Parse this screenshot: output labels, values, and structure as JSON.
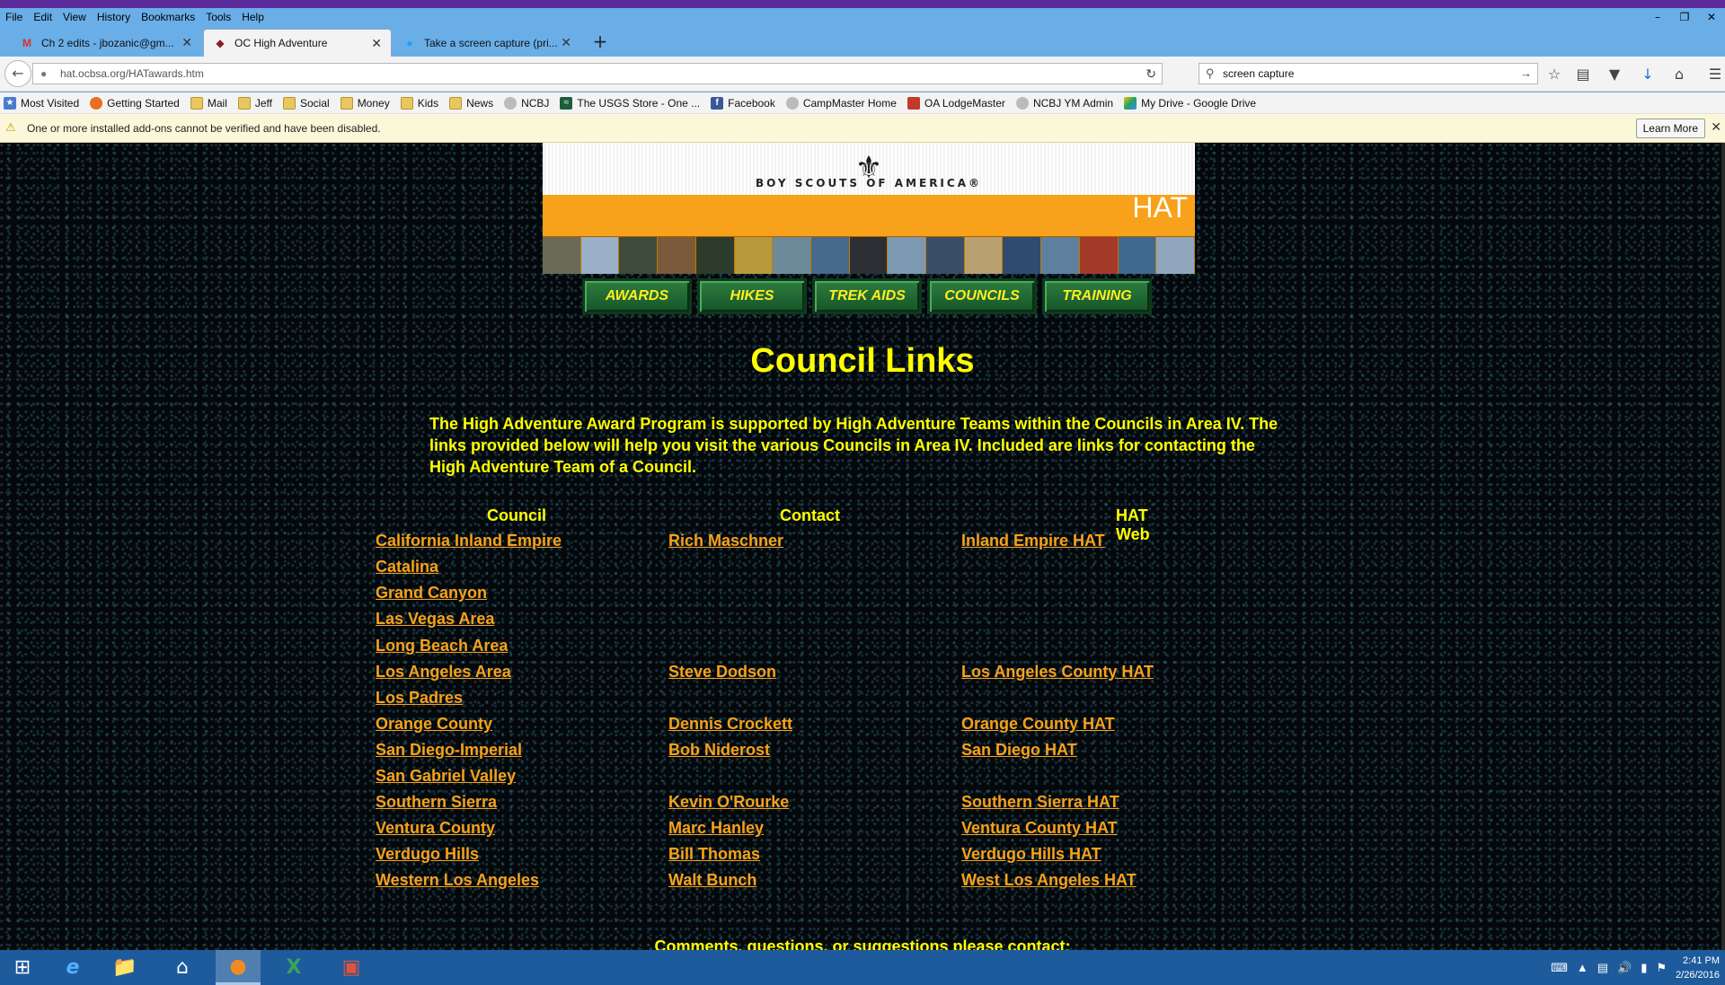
{
  "menu": [
    "File",
    "Edit",
    "View",
    "History",
    "Bookmarks",
    "Tools",
    "Help"
  ],
  "tabs": [
    {
      "label": "Ch 2 edits - jbozanic@gm...",
      "icon": "gmail-icon"
    },
    {
      "label": "OC High Adventure",
      "icon": "site-icon"
    },
    {
      "label": "Take a screen capture (pri...",
      "icon": "twitter-icon"
    }
  ],
  "nav": {
    "url": "hat.ocbsa.org/HATawards.htm",
    "search_value": "screen capture"
  },
  "bookmarks": [
    "Most Visited",
    "Getting Started",
    "Mail",
    "Jeff",
    "Social",
    "Money",
    "Kids",
    "News",
    "NCBJ",
    "The USGS Store - One ...",
    "Facebook",
    "CampMaster Home",
    "OA LodgeMaster",
    "NCBJ YM Admin",
    "My Drive - Google Drive"
  ],
  "notice": {
    "text": "One or more installed add-ons cannot be verified and have been disabled.",
    "button": "Learn More"
  },
  "banner": {
    "org": "BOY SCOUTS    OF AMERICA®",
    "hat": "HAT"
  },
  "site_nav": [
    "AWARDS",
    "HIKES",
    "TREK AIDS",
    "COUNCILS",
    "TRAINING"
  ],
  "page": {
    "title": "Council Links",
    "intro": "The High Adventure Award Program is supported by High Adventure Teams within the Councils in Area IV. The links provided below will help you visit the various Councils in Area IV. Included are links for contacting the High Adventure Team of a Council.",
    "headers": [
      "Council",
      "Contact",
      "HAT Web"
    ],
    "rows": [
      {
        "council": "California Inland Empire",
        "contact": "Rich Maschner",
        "web": "Inland Empire HAT"
      },
      {
        "council": "Catalina",
        "contact": "",
        "web": ""
      },
      {
        "council": "Grand Canyon",
        "contact": "",
        "web": ""
      },
      {
        "council": "Las Vegas Area",
        "contact": "",
        "web": ""
      },
      {
        "council": "Long Beach Area",
        "contact": "",
        "web": ""
      },
      {
        "council": "Los Angeles Area",
        "contact": "Steve Dodson",
        "web": "Los Angeles County HAT"
      },
      {
        "council": "Los Padres",
        "contact": "",
        "web": ""
      },
      {
        "council": "Orange County",
        "contact": "Dennis Crockett",
        "web": "Orange County HAT"
      },
      {
        "council": "San Diego-Imperial",
        "contact": "Bob Niderost",
        "web": "San Diego HAT"
      },
      {
        "council": "San Gabriel Valley",
        "contact": "",
        "web": ""
      },
      {
        "council": "Southern Sierra",
        "contact": "Kevin O'Rourke",
        "web": "Southern Sierra HAT"
      },
      {
        "council": "Ventura County",
        "contact": "Marc Hanley",
        "web": "Ventura County HAT"
      },
      {
        "council": "Verdugo Hills",
        "contact": "Bill Thomas",
        "web": "Verdugo Hills HAT"
      },
      {
        "council": "Western Los Angeles",
        "contact": "Walt Bunch",
        "web": "West Los Angeles HAT"
      }
    ],
    "comments": "Comments, questions, or suggestions please contact:"
  },
  "taskbar": {
    "time": "2:41 PM",
    "date": "2/26/2016"
  },
  "colors": {
    "title_yellow": "#ffff00",
    "link_orange": "#f7a21a",
    "nav_green": "#1f6a34",
    "banner_orange": "#f7a21a"
  }
}
